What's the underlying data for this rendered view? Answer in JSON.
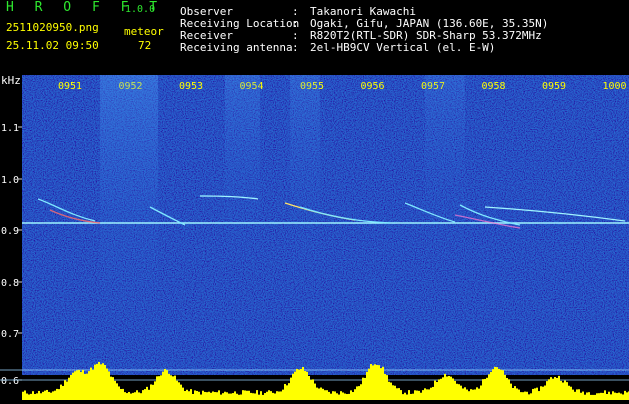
{
  "header": {
    "app_name": "H R O F F T",
    "app_version": "1.0.0",
    "file_name": "2511020950.png",
    "datetime": "25.11.02 09:50",
    "meteor_label": "meteor",
    "meteor_count": "72"
  },
  "station_info": [
    {
      "key": "Observer",
      "sep": ":",
      "value": "Takanori Kawachi"
    },
    {
      "key": "Receiving Location",
      "sep": ":",
      "value": "Ogaki, Gifu, JAPAN (136.60E, 35.35N)"
    },
    {
      "key": "Receiver",
      "sep": ":",
      "value": "R820T2(RTL-SDR) SDR-Sharp 53.372MHz"
    },
    {
      "key": "Receiving antenna",
      "sep": ":",
      "value": "2el-HB9CV Vertical (el. E-W)"
    }
  ],
  "spectrogram": {
    "y_unit": "kHz",
    "y_ticks": [
      "1.1",
      "1.0",
      "0.9",
      "0.8",
      "0.7",
      "0.6"
    ],
    "time_ticks": [
      "0951",
      "0952",
      "0953",
      "0954",
      "0955",
      "0956",
      "0957",
      "0958",
      "0959",
      "1000"
    ],
    "colors": {
      "background": "#0a1f9e",
      "time_label": "#ffff00",
      "axis_label": "#ffffff",
      "carrier": "#9ff4ff",
      "level_bar": "#ffff00"
    }
  }
}
